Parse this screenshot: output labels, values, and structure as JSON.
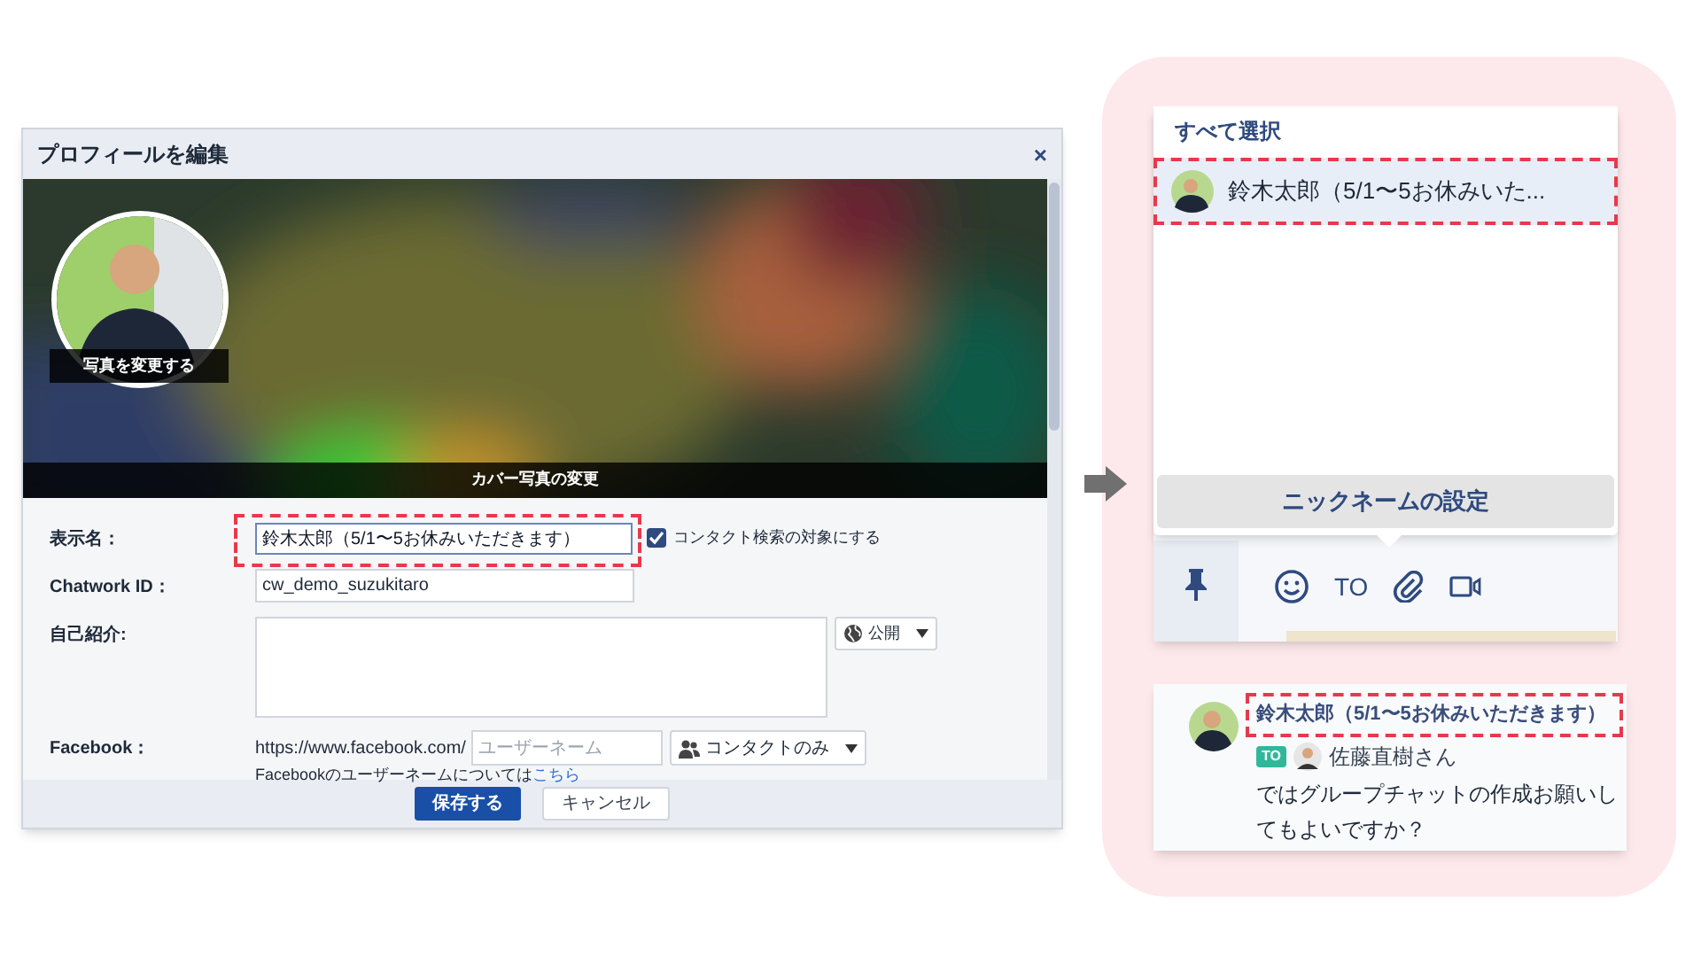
{
  "dialog": {
    "title": "プロフィールを編集",
    "close": "×",
    "photo_button": "写真を変更する",
    "cover_button": "カバー写真の変更",
    "display_name": {
      "label": "表示名：",
      "value": "鈴木太郎（5/1〜5お休みいただきます）",
      "checkbox": {
        "label": "コンタクト検索の対象にする",
        "checked": true
      }
    },
    "chatwork_id": {
      "label": "Chatwork ID：",
      "value": "cw_demo_suzukitaro"
    },
    "intro": {
      "label": "自己紹介:",
      "visibility": "公開"
    },
    "facebook": {
      "label": "Facebook：",
      "prefix": "https://www.facebook.com/",
      "placeholder": "ユーザーネーム",
      "visibility": "コンタクトのみ",
      "note": "Facebookのユーザーネームについては",
      "link": "こちら"
    },
    "buttons": [
      {
        "label": "保存する",
        "kind": "primary"
      },
      {
        "label": "キャンセル",
        "kind": "secondary"
      }
    ]
  },
  "mention_popup": {
    "select_all": "すべて選択",
    "items": [
      {
        "name": "鈴木太郎（5/1〜5お休みいた...",
        "selected": true
      }
    ],
    "nickname_button": "ニックネームの設定",
    "toolbar": {
      "to_label": "TO"
    }
  },
  "message": {
    "sender": "鈴木太郎（5/1〜5お休みいただきます）",
    "to_badge": "TO",
    "recipient": "佐藤直樹さん",
    "lines": [
      "ではグループチャットの作成お願いし",
      "てもよいですか？"
    ]
  }
}
